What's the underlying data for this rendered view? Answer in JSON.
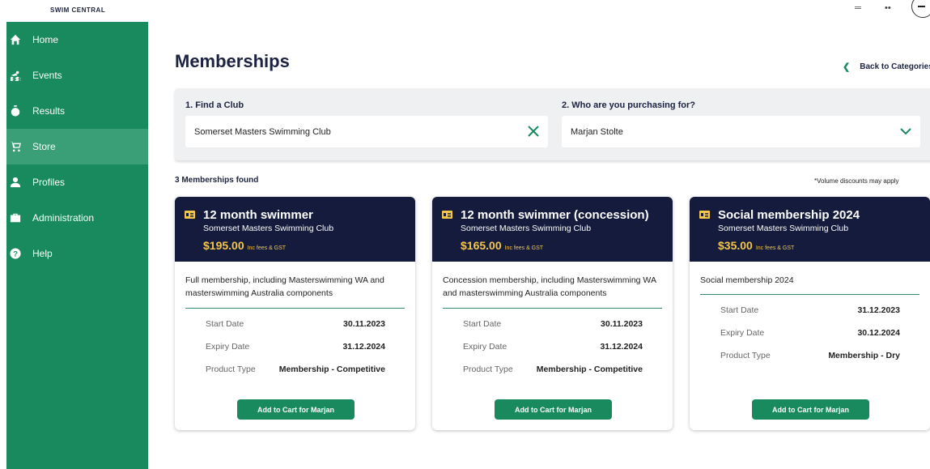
{
  "app": {
    "brand": "SWIM CENTRAL"
  },
  "sidebar": {
    "items": [
      {
        "label": "Home",
        "icon": "home-icon",
        "active": false
      },
      {
        "label": "Events",
        "icon": "swimmer-icon",
        "active": false
      },
      {
        "label": "Results",
        "icon": "stopwatch-icon",
        "active": false
      },
      {
        "label": "Store",
        "icon": "cart-icon",
        "active": true
      },
      {
        "label": "Profiles",
        "icon": "person-icon",
        "active": false
      },
      {
        "label": "Administration",
        "icon": "briefcase-icon",
        "active": false
      },
      {
        "label": "Help",
        "icon": "help-icon",
        "active": false
      }
    ]
  },
  "main": {
    "title": "Memberships",
    "back_label": "Back to Categories",
    "filters": {
      "club_label": "1. Find a Club",
      "club_value": "Somerset Masters Swimming Club",
      "purchaser_label": "2. Who are you purchasing for?",
      "purchaser_value": "Marjan Stolte"
    },
    "results_count": "3 Memberships found",
    "discount_note": "*Volume discounts may apply",
    "cards": [
      {
        "title": "12 month swimmer",
        "club": "Somerset Masters Swimming Club",
        "price": "$195.00",
        "price_note": "Inc fees & GST",
        "description": "Full membership, including Masterswimming WA and masterswimming Australia components",
        "rows": [
          {
            "key": "Start Date",
            "value": "30.11.2023"
          },
          {
            "key": "Expiry Date",
            "value": "31.12.2024"
          },
          {
            "key": "Product Type",
            "value": "Membership - Competitive"
          }
        ],
        "button": "Add to Cart for Marjan"
      },
      {
        "title": "12 month swimmer (concession)",
        "club": "Somerset Masters Swimming Club",
        "price": "$165.00",
        "price_note": "Inc fees & GST",
        "description": "Concession membership, including Masterswimming WA and masterswimming Australia components",
        "rows": [
          {
            "key": "Start Date",
            "value": "30.11.2023"
          },
          {
            "key": "Expiry Date",
            "value": "31.12.2024"
          },
          {
            "key": "Product Type",
            "value": "Membership - Competitive"
          }
        ],
        "button": "Add to Cart for Marjan"
      },
      {
        "title": "Social membership 2024",
        "club": "Somerset Masters Swimming Club",
        "price": "$35.00",
        "price_note": "Inc fees & GST",
        "description": "Social membership 2024",
        "rows": [
          {
            "key": "Start Date",
            "value": "31.12.2023"
          },
          {
            "key": "Expiry Date",
            "value": "30.12.2024"
          },
          {
            "key": "Product Type",
            "value": "Membership - Dry"
          }
        ],
        "button": "Add to Cart for Marjan"
      }
    ]
  },
  "colors": {
    "sidebar": "#188a5e",
    "sidebar_active": "#3a9e77",
    "card_header": "#141b3c",
    "price": "#f4c64a",
    "accent": "#188a5e"
  }
}
